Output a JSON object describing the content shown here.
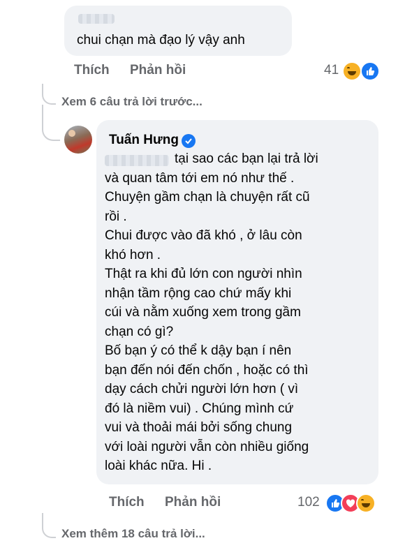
{
  "comment1": {
    "text": "chui chạn mà đạo lý vậy anh",
    "actions": {
      "like": "Thích",
      "reply": "Phản hồi"
    },
    "reaction_count": "41",
    "reactions": [
      "haha-icon",
      "like-icon"
    ]
  },
  "view_previous": "Xem 6 câu trả lời trước...",
  "reply": {
    "author": "Tuấn Hưng",
    "verified_icon": "verified-badge-icon",
    "text": "tại sao các bạn lại trả lời\nvà quan tâm tới em nó như thế .\nChuyện gầm chạn là chuyện rất cũ\nrồi .\nChui được vào đã khó , ở lâu còn\nkhó hơn .\nThật ra khi đủ lớn con người nhìn\nnhận tầm rộng cao chứ mấy khi\ncúi và nằm xuống xem trong gầm\nchạn có gì?\nBố bạn ý có thể k dậy bạn í nên\nbạn đến nói đến chốn , hoặc có thì\ndạy cách chửi người lớn hơn ( vì\nđó là niềm vui) . Chúng mình cứ\nvui và thoải mái bởi sống chung\nvới loài người vẫn còn nhiều giống\nloài khác nữa. Hi .",
    "actions": {
      "like": "Thích",
      "reply": "Phản hồi"
    },
    "reaction_count": "102",
    "reactions": [
      "like-icon",
      "love-icon",
      "haha-icon"
    ]
  },
  "view_more": "Xem thêm 18 câu trả lời...",
  "colors": {
    "bubble": "#f0f2f5",
    "secondary_text": "#65676b",
    "like_blue": "#1877f2",
    "love_red": "#f33e58",
    "haha_yellow": "#f7b125"
  }
}
